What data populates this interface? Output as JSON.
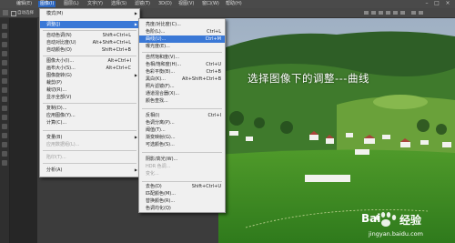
{
  "menubar": {
    "items": [
      {
        "label": "编辑(E)",
        "active": false
      },
      {
        "label": "图像(I)",
        "active": true
      },
      {
        "label": "图层(L)",
        "active": false
      },
      {
        "label": "文字(Y)",
        "active": false
      },
      {
        "label": "选择(S)",
        "active": false
      },
      {
        "label": "滤镜(T)",
        "active": false
      },
      {
        "label": "3D(D)",
        "active": false
      },
      {
        "label": "视图(V)",
        "active": false
      },
      {
        "label": "窗口(W)",
        "active": false
      },
      {
        "label": "帮助(H)",
        "active": false
      }
    ]
  },
  "optionsbar": {
    "text": "自动选择"
  },
  "image_menu": {
    "items": [
      {
        "label": "模式(M)",
        "shortcut": "",
        "arrow": true,
        "disabled": false,
        "highlighted": false
      },
      {
        "label": "调整(J)",
        "shortcut": "",
        "arrow": true,
        "disabled": false,
        "highlighted": true
      },
      {
        "label": "自动色调(N)",
        "shortcut": "Shift+Ctrl+L",
        "arrow": false,
        "disabled": false,
        "highlighted": false
      },
      {
        "label": "自动对比度(U)",
        "shortcut": "Alt+Shift+Ctrl+L",
        "arrow": false,
        "disabled": false,
        "highlighted": false
      },
      {
        "label": "自动颜色(O)",
        "shortcut": "Shift+Ctrl+B",
        "arrow": false,
        "disabled": false,
        "highlighted": false
      },
      {
        "label": "图像大小(I)...",
        "shortcut": "Alt+Ctrl+I",
        "arrow": false,
        "disabled": false,
        "highlighted": false
      },
      {
        "label": "画布大小(S)...",
        "shortcut": "Alt+Ctrl+C",
        "arrow": false,
        "disabled": false,
        "highlighted": false
      },
      {
        "label": "图像旋转(G)",
        "shortcut": "",
        "arrow": true,
        "disabled": false,
        "highlighted": false
      },
      {
        "label": "裁剪(P)",
        "shortcut": "",
        "arrow": false,
        "disabled": false,
        "highlighted": false
      },
      {
        "label": "裁切(R)...",
        "shortcut": "",
        "arrow": false,
        "disabled": false,
        "highlighted": false
      },
      {
        "label": "显示全部(V)",
        "shortcut": "",
        "arrow": false,
        "disabled": false,
        "highlighted": false
      },
      {
        "label": "复制(D)...",
        "shortcut": "",
        "arrow": false,
        "disabled": false,
        "highlighted": false
      },
      {
        "label": "应用图像(Y)...",
        "shortcut": "",
        "arrow": false,
        "disabled": false,
        "highlighted": false
      },
      {
        "label": "计算(C)...",
        "shortcut": "",
        "arrow": false,
        "disabled": false,
        "highlighted": false
      },
      {
        "label": "变量(B)",
        "shortcut": "",
        "arrow": true,
        "disabled": false,
        "highlighted": false
      },
      {
        "label": "应用数据组(L)...",
        "shortcut": "",
        "arrow": false,
        "disabled": true,
        "highlighted": false
      },
      {
        "label": "陷印(T)...",
        "shortcut": "",
        "arrow": false,
        "disabled": true,
        "highlighted": false
      },
      {
        "label": "分析(A)",
        "shortcut": "",
        "arrow": true,
        "disabled": false,
        "highlighted": false
      }
    ]
  },
  "adjust_menu": {
    "items": [
      {
        "label": "亮度/对比度(C)...",
        "shortcut": "",
        "disabled": false,
        "highlighted": false
      },
      {
        "label": "色阶(L)...",
        "shortcut": "Ctrl+L",
        "disabled": false,
        "highlighted": false
      },
      {
        "label": "曲线(U)...",
        "shortcut": "Ctrl+M",
        "disabled": false,
        "highlighted": true
      },
      {
        "label": "曝光度(E)...",
        "shortcut": "",
        "disabled": false,
        "highlighted": false
      },
      {
        "label": "自然饱和度(V)...",
        "shortcut": "",
        "disabled": false,
        "highlighted": false
      },
      {
        "label": "色相/饱和度(H)...",
        "shortcut": "Ctrl+U",
        "disabled": false,
        "highlighted": false
      },
      {
        "label": "色彩平衡(B)...",
        "shortcut": "Ctrl+B",
        "disabled": false,
        "highlighted": false
      },
      {
        "label": "黑白(K)...",
        "shortcut": "Alt+Shift+Ctrl+B",
        "disabled": false,
        "highlighted": false
      },
      {
        "label": "照片滤镜(F)...",
        "shortcut": "",
        "disabled": false,
        "highlighted": false
      },
      {
        "label": "通道混合器(X)...",
        "shortcut": "",
        "disabled": false,
        "highlighted": false
      },
      {
        "label": "颜色查找...",
        "shortcut": "",
        "disabled": false,
        "highlighted": false
      },
      {
        "label": "反相(I)",
        "shortcut": "Ctrl+I",
        "disabled": false,
        "highlighted": false
      },
      {
        "label": "色调分离(P)...",
        "shortcut": "",
        "disabled": false,
        "highlighted": false
      },
      {
        "label": "阈值(T)...",
        "shortcut": "",
        "disabled": false,
        "highlighted": false
      },
      {
        "label": "渐变映射(G)...",
        "shortcut": "",
        "disabled": false,
        "highlighted": false
      },
      {
        "label": "可选颜色(S)...",
        "shortcut": "",
        "disabled": false,
        "highlighted": false
      },
      {
        "label": "阴影/高光(W)...",
        "shortcut": "",
        "disabled": false,
        "highlighted": false
      },
      {
        "label": "HDR 色调...",
        "shortcut": "",
        "disabled": true,
        "highlighted": false
      },
      {
        "label": "变化...",
        "shortcut": "",
        "disabled": true,
        "highlighted": false
      },
      {
        "label": "去色(D)",
        "shortcut": "Shift+Ctrl+U",
        "disabled": false,
        "highlighted": false
      },
      {
        "label": "匹配颜色(M)...",
        "shortcut": "",
        "disabled": false,
        "highlighted": false
      },
      {
        "label": "替换颜色(R)...",
        "shortcut": "",
        "disabled": false,
        "highlighted": false
      },
      {
        "label": "色调均化(Q)",
        "shortcut": "",
        "disabled": false,
        "highlighted": false
      }
    ]
  },
  "overlay": {
    "caption": "选择图像下的调整---曲线"
  },
  "watermark": {
    "brand": "Bai",
    "brand2": "经验",
    "url": "jingyan.baidu.com"
  },
  "colors": {
    "highlight": "#3a78d6",
    "menu_bg": "#f0f0f0",
    "ui_dark": "#3c3c3c"
  }
}
